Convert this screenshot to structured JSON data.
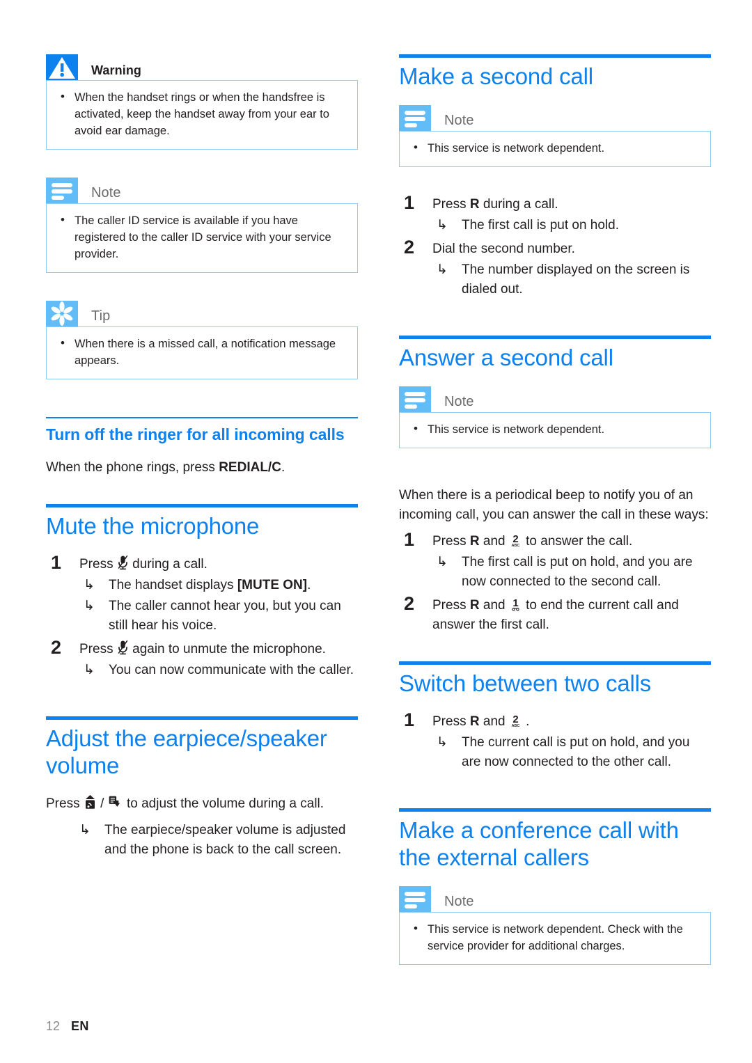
{
  "page": {
    "number": "12",
    "language": "EN"
  },
  "colors": {
    "accent_blue": "#0d82ee",
    "icon_blue_light": "#62bdf6",
    "callout_border": "#8ecdf5",
    "text": "#231f20",
    "callout_title_gray": "#6b6b6b",
    "footer_page_gray": "#8a8a8a"
  },
  "left_column": {
    "warning_callout": {
      "icon": "warning-triangle-icon",
      "title": "Warning",
      "items": [
        "When the handset rings or when the handsfree is activated, keep the handset away from your ear to avoid ear damage."
      ]
    },
    "note_callout": {
      "icon": "note-lines-icon",
      "title": "Note",
      "items": [
        "The caller ID service is available if you have registered to the caller ID service with your service provider."
      ]
    },
    "tip_callout": {
      "icon": "tip-starburst-icon",
      "title": "Tip",
      "items": [
        "When there is a missed call, a notification message appears."
      ]
    },
    "subsection_ringer": {
      "heading": "Turn off the ringer for all incoming calls",
      "body_prefix": "When the phone rings, press ",
      "body_key": "REDIAL/C",
      "body_suffix": "."
    },
    "section_mute": {
      "heading": "Mute the microphone",
      "steps": [
        {
          "num": "1",
          "text_before_icon": "Press ",
          "icon": "mute-microphone-icon",
          "text_after_icon": " during a call.",
          "results": [
            {
              "prefix": "The handset displays ",
              "bold": "[MUTE ON]",
              "suffix": "."
            },
            {
              "prefix": "The caller cannot hear you, but you can still hear his voice.",
              "bold": "",
              "suffix": ""
            }
          ]
        },
        {
          "num": "2",
          "text_before_icon": "Press ",
          "icon": "mute-microphone-icon",
          "text_after_icon": " again to unmute the microphone.",
          "results": [
            {
              "prefix": "You can now communicate with the caller.",
              "bold": "",
              "suffix": ""
            }
          ]
        }
      ]
    },
    "section_volume": {
      "heading": "Adjust the earpiece/speaker volume",
      "body_prefix": "Press ",
      "icon_up": "volume-up-key-icon",
      "separator": " / ",
      "icon_down": "volume-down-key-icon",
      "body_suffix": " to adjust the volume during a call.",
      "results": [
        "The earpiece/speaker volume is adjusted and the phone is back to the call screen."
      ]
    }
  },
  "right_column": {
    "section_make_second_call": {
      "heading": "Make a second call",
      "note": {
        "icon": "note-lines-icon",
        "title": "Note",
        "items": [
          "This service is network dependent."
        ]
      },
      "steps": [
        {
          "num": "1",
          "text_before_key": "Press ",
          "key": "R",
          "text_after_key": " during a call.",
          "results": [
            "The first call is put on hold."
          ]
        },
        {
          "num": "2",
          "text_before_key": "Dial the second number.",
          "key": "",
          "text_after_key": "",
          "results": [
            "The number displayed on the screen is dialed out."
          ]
        }
      ]
    },
    "section_answer_second_call": {
      "heading": "Answer a second call",
      "note": {
        "icon": "note-lines-icon",
        "title": "Note",
        "items": [
          "This service is network dependent."
        ]
      },
      "intro": "When there is a periodical beep to notify you of an incoming call, you can answer the call in these ways:",
      "steps": [
        {
          "num": "1",
          "text_before_key": "Press ",
          "key": "R",
          "text_mid": " and ",
          "icon": "key-2-abc-icon",
          "text_after_icon": " to answer the call.",
          "results": [
            "The first call is put on hold, and you are now connected to the second call."
          ]
        },
        {
          "num": "2",
          "text_before_key": "Press ",
          "key": "R",
          "text_mid": " and ",
          "icon": "key-1-voicemail-icon",
          "text_after_icon": " to end the current call and answer the first call.",
          "results": []
        }
      ]
    },
    "section_switch_calls": {
      "heading": "Switch between two calls",
      "steps": [
        {
          "num": "1",
          "text_before_key": "Press ",
          "key": "R",
          "text_mid": " and ",
          "icon": "key-2-abc-icon",
          "text_after_icon": " .",
          "results": [
            "The current call is put on hold, and you are now connected to the other call."
          ]
        }
      ]
    },
    "section_conference_call": {
      "heading": "Make a conference call with the external callers",
      "note": {
        "icon": "note-lines-icon",
        "title": "Note",
        "items": [
          "This service is network dependent. Check with the service provider for additional charges."
        ]
      }
    }
  }
}
